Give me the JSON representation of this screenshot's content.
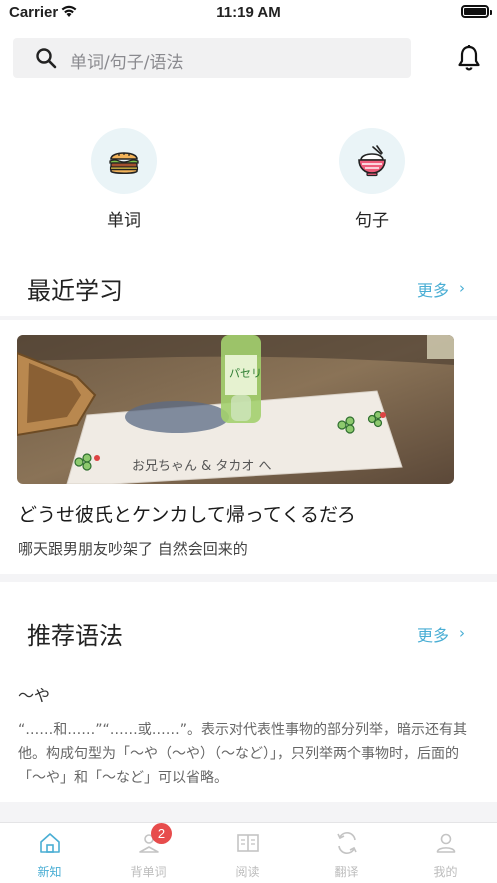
{
  "status_bar": {
    "carrier": "Carrier",
    "time": "11:19 AM"
  },
  "search": {
    "placeholder": "单词/句子/语法"
  },
  "quick_links": [
    {
      "label": "单词",
      "icon": "hamburger-icon"
    },
    {
      "label": "句子",
      "icon": "rice-bowl-icon"
    }
  ],
  "recent": {
    "title": "最近学习",
    "more": "更多",
    "card": {
      "image_handwriting": "お兄ちゃん & タカオ へ",
      "japanese": "どうせ彼氏とケンカして帰ってくるだろ",
      "chinese": "哪天跟男朋友吵架了 自然会回来的"
    }
  },
  "grammar": {
    "title": "推荐语法",
    "more": "更多",
    "card": {
      "pattern": "～や",
      "description": "“……和……”“……或……”。表示对代表性事物的部分列举，暗示还有其他。构成句型为「～や（～や）（～など）」，只列举两个事物时，后面的「～や」和「～など」可以省略。"
    }
  },
  "tabs": [
    {
      "label": "新知",
      "icon": "home-icon",
      "active": true
    },
    {
      "label": "背单词",
      "icon": "study-icon",
      "badge": "2"
    },
    {
      "label": "阅读",
      "icon": "book-icon"
    },
    {
      "label": "翻译",
      "icon": "translate-icon"
    },
    {
      "label": "我的",
      "icon": "profile-icon"
    }
  ],
  "colors": {
    "accent": "#4aaed4",
    "badge": "#e74c4c",
    "icon_bg": "#eaf4f7"
  }
}
